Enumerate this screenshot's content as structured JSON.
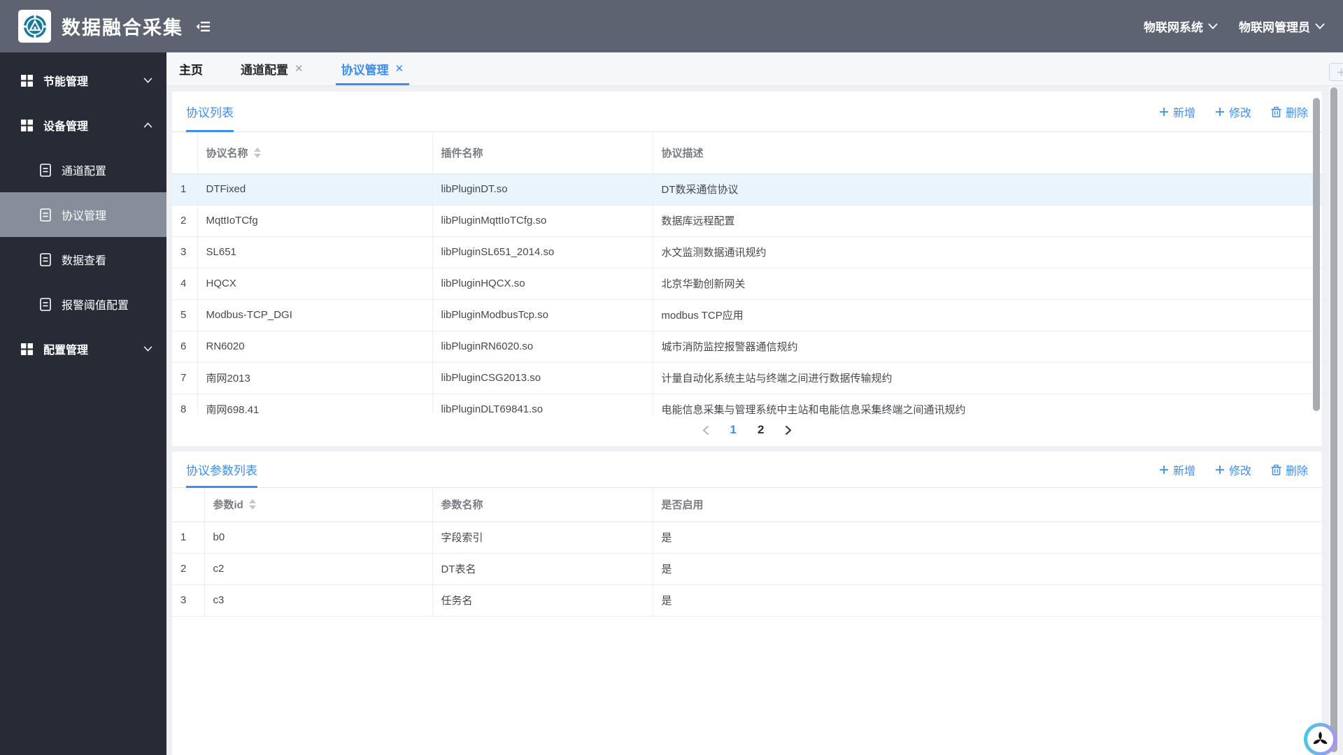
{
  "header": {
    "app_title": "数据融合采集",
    "system_menu": "物联网系统",
    "user_menu": "物联网管理员"
  },
  "sidebar": {
    "groups": [
      {
        "label": "节能管理",
        "expanded": false
      },
      {
        "label": "设备管理",
        "expanded": true,
        "children": [
          {
            "label": "通道配置",
            "active": false
          },
          {
            "label": "协议管理",
            "active": true
          },
          {
            "label": "数据查看",
            "active": false
          },
          {
            "label": "报警阈值配置",
            "active": false
          }
        ]
      },
      {
        "label": "配置管理",
        "expanded": false
      }
    ]
  },
  "tabs": {
    "items": [
      {
        "label": "主页",
        "closable": false,
        "active": false
      },
      {
        "label": "通道配置",
        "closable": true,
        "active": false
      },
      {
        "label": "协议管理",
        "closable": true,
        "active": true
      }
    ]
  },
  "protocol_panel": {
    "title": "协议列表",
    "actions": [
      {
        "label": "新增",
        "icon": "plus-icon"
      },
      {
        "label": "修改",
        "icon": "plus-icon"
      },
      {
        "label": "删除",
        "icon": "trash-icon"
      }
    ],
    "columns": {
      "index": "",
      "name": "协议名称",
      "plugin": "插件名称",
      "desc": "协议描述"
    },
    "sorted_column": "协议名称",
    "rows": [
      [
        "1",
        "DTFixed",
        "libPluginDT.so",
        "DT数采通信协议"
      ],
      [
        "2",
        "MqttIoTCfg",
        "libPluginMqttIoTCfg.so",
        "数据库远程配置"
      ],
      [
        "3",
        "SL651",
        "libPluginSL651_2014.so",
        "水文监测数据通讯规约"
      ],
      [
        "4",
        "HQCX",
        "libPluginHQCX.so",
        "北京华勤创新网关"
      ],
      [
        "5",
        "Modbus-TCP_DGI",
        "libPluginModbusTcp.so",
        "modbus TCP应用"
      ],
      [
        "6",
        "RN6020",
        "libPluginRN6020.so",
        "城市消防监控报警器通信规约"
      ],
      [
        "7",
        "南网2013",
        "libPluginCSG2013.so",
        "计量自动化系统主站与终端之间进行数据传输规约"
      ],
      [
        "8",
        "南网698.41",
        "libPluginDLT69841.so",
        "电能信息采集与管理系统中主站和电能信息采集终端之间通讯规约"
      ]
    ],
    "selected_row_index": 0,
    "pagination": {
      "pages": [
        "1",
        "2"
      ],
      "current": "1"
    }
  },
  "param_panel": {
    "title": "协议参数列表",
    "actions": [
      {
        "label": "新增",
        "icon": "plus-icon"
      },
      {
        "label": "修改",
        "icon": "plus-icon"
      },
      {
        "label": "删除",
        "icon": "trash-icon"
      }
    ],
    "columns": {
      "index": "",
      "id": "参数id",
      "name": "参数名称",
      "enabled": "是否启用"
    },
    "sorted_column": "参数id",
    "rows": [
      [
        "1",
        "b0",
        "字段索引",
        "是"
      ],
      [
        "2",
        "c2",
        "DT表名",
        "是"
      ],
      [
        "3",
        "c3",
        "任务名",
        "是"
      ]
    ]
  },
  "icons": [
    "app-emblem",
    "sidebar-collapse-icon",
    "chevron-down-icon",
    "chevron-up-icon",
    "grid-icon",
    "document-icon",
    "plus-icon",
    "trash-icon",
    "close-icon",
    "sort-caret-icon",
    "new-tab-plus-icon",
    "brand-watermark-icon"
  ],
  "colors": {
    "accent_blue": "#3d8ef2",
    "header_bg": "#5d6370",
    "sidebar_bg": "#262b36",
    "sidebar_active_bg": "#868e99",
    "selected_row_bg": "#eaf4fd",
    "logo_teal": "#17799c"
  }
}
